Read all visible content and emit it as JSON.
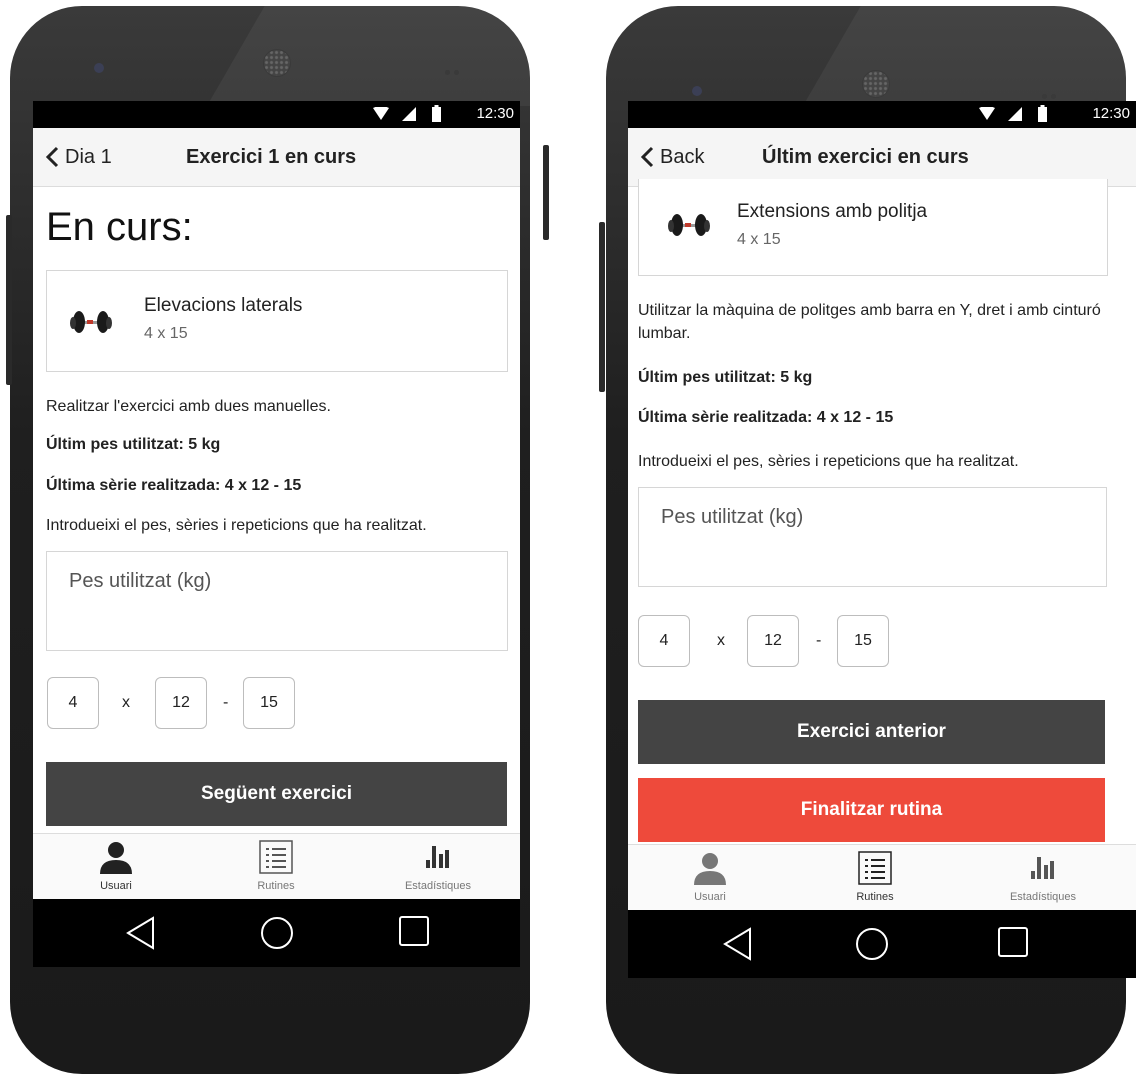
{
  "status": {
    "time": "12:30"
  },
  "screens": [
    {
      "back_label": "Dia 1",
      "title": "Exercici 1 en curs",
      "heading": "En curs:",
      "exercise": {
        "name": "Elevacions laterals",
        "sets": "4 x 15"
      },
      "description": "Realitzar l'exercici amb dues manuelles.",
      "last_weight": "Últim pes utilitzat: 5 kg",
      "last_series": "Última sèrie realitzada: 4 x 12 - 15",
      "instruction": "Introdueixi el pes, sèries i repeticions que ha realitzat.",
      "weight_placeholder": "Pes utilitzat (kg)",
      "sets_value": "4",
      "times_sep": "x",
      "reps_min": "12",
      "dash_sep": "-",
      "reps_max": "15",
      "primary_button": "Següent exercici"
    },
    {
      "back_label": "Back",
      "title": "Últim exercici en curs",
      "exercise": {
        "name": "Extensions amb politja",
        "sets": "4 x 15"
      },
      "description": "Utilitzar la màquina de politges amb barra en Y, dret i amb cinturó lumbar.",
      "last_weight": "Últim pes utilitzat: 5 kg",
      "last_series": "Última sèrie realitzada: 4 x 12 - 15",
      "instruction": "Introdueixi el pes, sèries i repeticions que ha realitzat.",
      "weight_placeholder": "Pes utilitzat (kg)",
      "sets_value": "4",
      "times_sep": "x",
      "reps_min": "12",
      "dash_sep": "-",
      "reps_max": "15",
      "secondary_button": "Exercici anterior",
      "finish_button": "Finalitzar rutina"
    }
  ],
  "tabs": {
    "user": "Usuari",
    "routines": "Rutines",
    "stats": "Estadístiques"
  },
  "colors": {
    "dark_button": "#444444",
    "finish_button": "#ee4a3b",
    "tab_active": "#333333"
  }
}
